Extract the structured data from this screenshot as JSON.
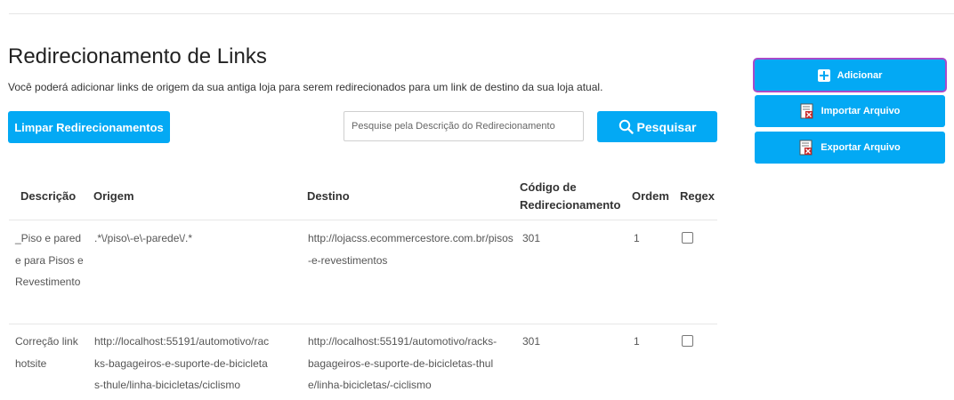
{
  "header": {
    "title": "Redirecionamento de Links",
    "subtitle": "Você poderá adicionar links de origem da sua antiga loja para serem redirecionados para um link de destino da sua loja atual."
  },
  "toolbar": {
    "clear_label": "Limpar Redirecionamentos",
    "search_placeholder": "Pesquise pela Descrição do Redirecionamento",
    "search_value": "",
    "search_label": "Pesquisar"
  },
  "side_actions": {
    "add_label": "Adicionar",
    "import_label": "Importar Arquivo",
    "export_label": "Exportar Arquivo"
  },
  "table": {
    "columns": {
      "descricao": "Descrição",
      "origem": "Origem",
      "destino": "Destino",
      "codigo_line1": "Código de",
      "codigo_line2": "Redirecionamento",
      "ordem": "Ordem",
      "regex": "Regex"
    },
    "rows": [
      {
        "descricao": "_Piso e parede para Pisos e Revestimento",
        "origem": ".*\\/piso\\-e\\-parede\\/.*",
        "destino": "http://lojacss.ecommercestore.com.br/pisos-e-revestimentos",
        "codigo": "301",
        "ordem": "1",
        "regex": false
      },
      {
        "descricao": "Correção link hotsite",
        "origem": "http://localhost:55191/automotivo/racks-bagageiros-e-suporte-de-bicicletas-thule/linha-bicicletas/ciclismo",
        "destino": "http://localhost:55191/automotivo/racks-bagageiros-e-suporte-de-bicicletas-thule/linha-bicicletas/-ciclismo",
        "codigo": "301",
        "ordem": "1",
        "regex": false
      }
    ]
  },
  "colors": {
    "primary": "#03a9f4",
    "focus_outline": "#a84ac9"
  }
}
